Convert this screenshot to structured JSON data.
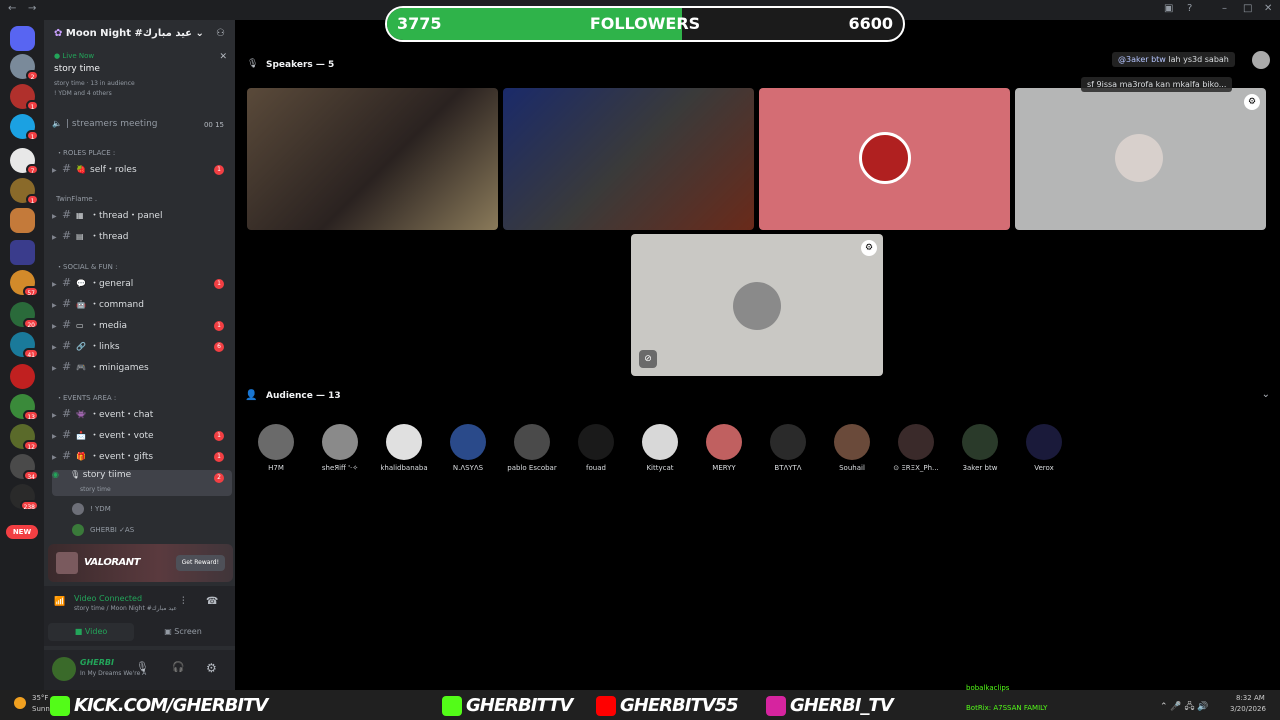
{
  "followers": {
    "current": "3775",
    "label": "FOLLOWERS",
    "goal": "6600",
    "progress": 0.572
  },
  "server": {
    "name": "Moon Night #عيد مبارك"
  },
  "live": {
    "label": "Live Now",
    "title": "story time",
    "meta": "story time · 13 in audience",
    "people": "! YDM and 4 others",
    "meeting": "| streamers meeting",
    "meeting_counts": "00  15"
  },
  "channels": [
    {
      "type": "cat",
      "label": "・ROLES PLACE :"
    },
    {
      "type": "text",
      "label": "self・roles",
      "badge": "1"
    },
    {
      "type": "cat",
      "label": "TwinFlame ."
    },
    {
      "type": "text",
      "label": "・thread・panel",
      "badge": ""
    },
    {
      "type": "text",
      "label": "・thread",
      "badge": ""
    },
    {
      "type": "cat",
      "label": "・SOCIAL & FUN :"
    },
    {
      "type": "text",
      "label": "・general",
      "badge": "1"
    },
    {
      "type": "text",
      "label": "・command",
      "badge": ""
    },
    {
      "type": "text",
      "label": "・media",
      "badge": "1"
    },
    {
      "type": "text",
      "label": "・links",
      "badge": "6"
    },
    {
      "type": "text",
      "label": "・minigames",
      "badge": ""
    },
    {
      "type": "cat",
      "label": "・EVENTS AREA :"
    },
    {
      "type": "text",
      "label": "・event・chat",
      "badge": ""
    },
    {
      "type": "text",
      "label": "・event・vote",
      "badge": "1"
    },
    {
      "type": "text",
      "label": "・event・gifts",
      "badge": "1"
    }
  ],
  "stage": {
    "label": "story tiime",
    "sub": "story time",
    "badge": "2",
    "users": [
      "! YDM",
      "GHERBI ✓AS"
    ]
  },
  "promo": {
    "name": "VALORANT",
    "button": "Get Reward!"
  },
  "voice": {
    "status": "Video Connected",
    "location": "story time / Moon Night #عيد مبارك",
    "video_btn": "Video",
    "screen_btn": "Screen"
  },
  "user": {
    "name": "GHERBI",
    "status": "In My Dreams We're A"
  },
  "speakers_title": "Speakers — 5",
  "audience_title": "Audience — 13",
  "audience": [
    "H7M",
    "sheЯiff '·✧",
    "khalidbanaba",
    "N.ΛSYΛS",
    "pablo Escobar",
    "fouad",
    "Kittycat",
    "MERYY",
    "BTΛYTΛ",
    "Souhail",
    "⊙ ΞRΞX_Ph...",
    "3aker btw",
    "Verox"
  ],
  "chat": [
    {
      "user": "@3aker btw",
      "text": "lah ys3d sabah"
    },
    {
      "text": "sf 9issa ma3rofa kan mkalfa biko..."
    }
  ],
  "overlay": {
    "kick": "KICK.COM/GHERBITV",
    "youtube": "GHERBITV55",
    "instagram": "GHERBI_TV",
    "weather": "35°F",
    "weather_sub": "Sunn",
    "time": "8:32 AM",
    "date": "3/20/2026",
    "bot1": "bobalkaclips",
    "bot2": "BotRix: A7SSAN FAMILY"
  },
  "colors": {
    "accent": "#23a55a",
    "badge": "#f23f43",
    "progress": "#2fb34a",
    "tile_red": "#d46d74",
    "tile_gray": "#b5b6b6"
  }
}
